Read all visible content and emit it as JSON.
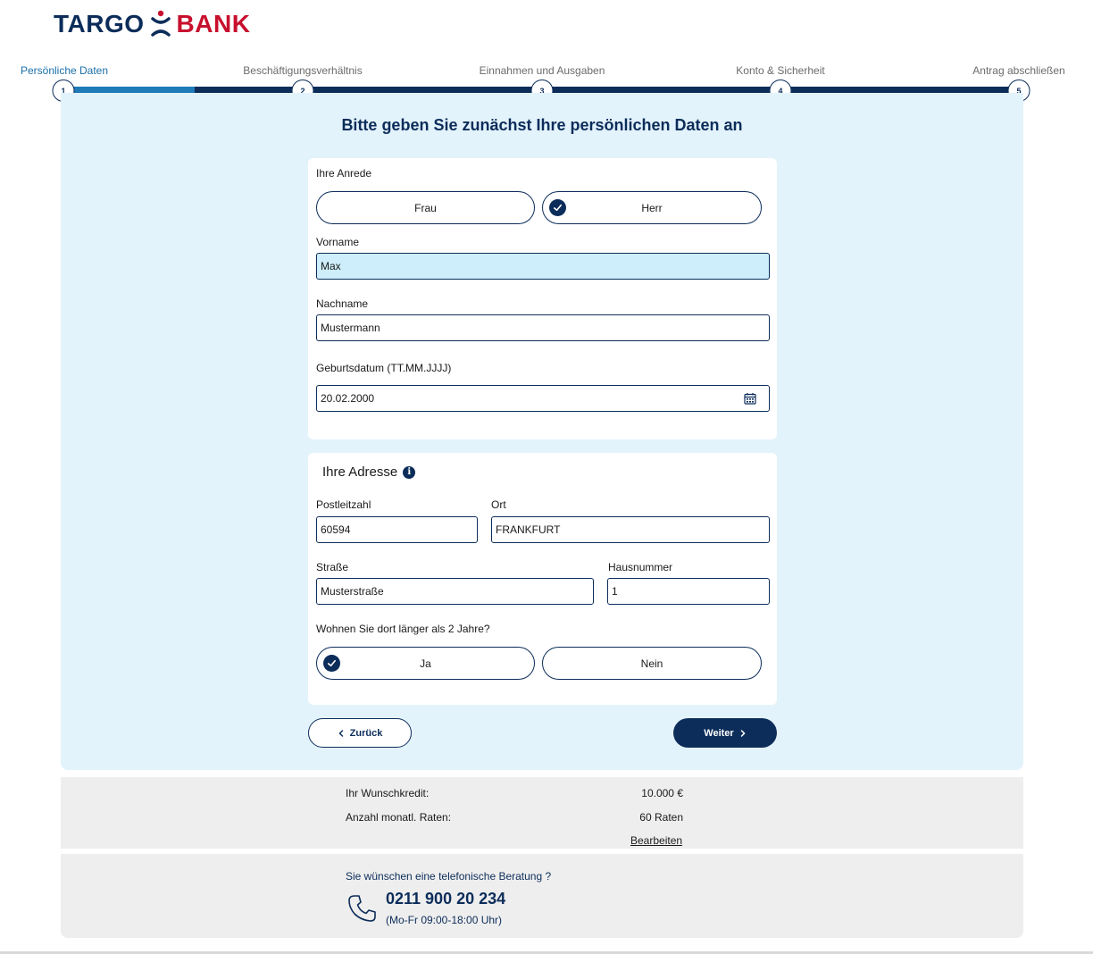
{
  "brand": {
    "name_part1": "TARGO",
    "name_part2": "BANK",
    "colors": {
      "navy": "#0c2d5a",
      "red": "#c8102e",
      "progress": "#1f7ab8",
      "panel": "#e3f3fc"
    }
  },
  "stepper": {
    "active_step": 1,
    "steps": [
      {
        "number": "1",
        "label": "Persönliche Daten"
      },
      {
        "number": "2",
        "label": "Beschäftigungsverhältnis"
      },
      {
        "number": "3",
        "label": "Einnahmen und Ausgaben"
      },
      {
        "number": "4",
        "label": "Konto & Sicherheit"
      },
      {
        "number": "5",
        "label": "Antrag abschließen"
      }
    ]
  },
  "page_title": "Bitte geben Sie zunächst Ihre persönlichen Daten an",
  "personal": {
    "salutation_label": "Ihre Anrede",
    "salutation_options": [
      "Frau",
      "Herr"
    ],
    "salutation_selected": "Herr",
    "firstname_label": "Vorname",
    "firstname_value": "Max",
    "lastname_label": "Nachname",
    "lastname_value": "Mustermann",
    "birthdate_label": "Geburtsdatum (TT.MM.JJJJ)",
    "birthdate_value": "20.02.2000",
    "calendar_icon": "calendar-icon"
  },
  "address": {
    "title": "Ihre Adresse",
    "info_icon": "info-icon",
    "zip_label": "Postleitzahl",
    "zip_value": "60594",
    "city_label": "Ort",
    "city_value": "FRANKFURT",
    "street_label": "Straße",
    "street_value": "Musterstraße",
    "housenumber_label": "Hausnummer",
    "housenumber_value": "1",
    "duration_question": "Wohnen Sie dort länger als 2 Jahre?",
    "duration_options": [
      "Ja",
      "Nein"
    ],
    "duration_selected": "Ja"
  },
  "navigation": {
    "back_label": "Zurück",
    "next_label": "Weiter"
  },
  "summary": {
    "credit_label": "Ihr Wunschkredit:",
    "credit_value": "10.000 €",
    "rates_label": "Anzahl monatl. Raten:",
    "rates_value": "60 Raten",
    "edit_label": "Bearbeiten"
  },
  "contact": {
    "question": "Sie wünschen eine telefonische Beratung ?",
    "phone": "0211 900 20 234",
    "hours": "(Mo-Fr 09:00-18:00 Uhr)",
    "phone_icon": "phone-icon"
  }
}
